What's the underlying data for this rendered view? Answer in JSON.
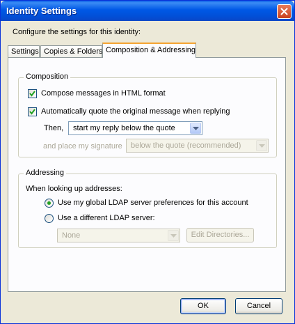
{
  "window": {
    "title": "Identity Settings"
  },
  "description": "Configure the settings for this identity:",
  "tabs": [
    {
      "label": "Settings"
    },
    {
      "label": "Copies & Folders"
    },
    {
      "label": "Composition & Addressing"
    }
  ],
  "composition": {
    "legend": "Composition",
    "html_checkbox": {
      "label": "Compose messages in HTML format",
      "checked": true
    },
    "quote_checkbox": {
      "label": "Automatically quote the original message when replying",
      "checked": true
    },
    "then_label": "Then,",
    "reply_select": {
      "value": "start my reply below the quote"
    },
    "signature_label": "and place my signature",
    "signature_select": {
      "value": "below the quote (recommended)"
    }
  },
  "addressing": {
    "legend": "Addressing",
    "intro": "When looking up addresses:",
    "radio_global": {
      "label": "Use my global LDAP server preferences for this account",
      "selected": true
    },
    "radio_different": {
      "label": "Use a different LDAP server:",
      "selected": false
    },
    "ldap_select": {
      "value": "None"
    },
    "edit_directories": "Edit Directories..."
  },
  "buttons": {
    "ok": "OK",
    "cancel": "Cancel"
  },
  "colors": {
    "titlebar": "#0058e6",
    "active_tab_accent": "#f5a432",
    "radio_dot": "#21a121",
    "dialog_bg": "#ece9d8"
  }
}
